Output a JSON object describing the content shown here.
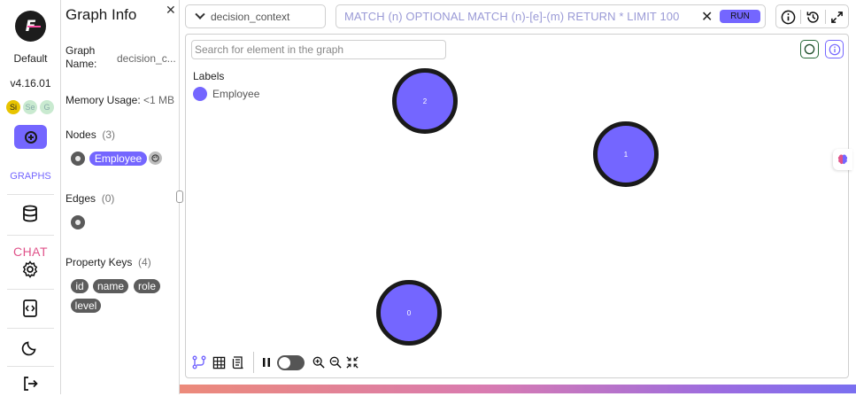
{
  "sidebar": {
    "logo_letter": "F",
    "workspace": "Default",
    "version": "v4.16.01",
    "avatars": [
      {
        "initials": "Si",
        "color": "#e8c400"
      },
      {
        "initials": "Se",
        "color": "#c9ead0"
      },
      {
        "initials": "G",
        "color": "#c9ead0"
      }
    ],
    "graphs_label": "GRAPHS",
    "chat_label": "CHAT"
  },
  "graph_info": {
    "title": "Graph Info",
    "graph_name_label": "Graph Name:",
    "graph_name_value": "decision_c...",
    "memory_label": "Memory Usage:",
    "memory_value": "<1 MB",
    "nodes_label": "Nodes",
    "nodes_count": "(3)",
    "node_labels": [
      "Employee"
    ],
    "edges_label": "Edges",
    "edges_count": "(0)",
    "property_keys_label": "Property Keys",
    "property_keys_count": "(4)",
    "property_keys": [
      "id",
      "name",
      "role",
      "level"
    ]
  },
  "toolbar": {
    "graph_select_value": "decision_context",
    "query_placeholder": "MATCH (n) OPTIONAL MATCH (n)-[e]-(m) RETURN * LIMIT 100",
    "run_label": "RUN"
  },
  "canvas": {
    "search_placeholder": "Search for element in the graph",
    "labels_title": "Labels",
    "legend": [
      {
        "label": "Employee",
        "color": "#7466ff"
      }
    ],
    "nodes": [
      {
        "id": "2"
      },
      {
        "id": "1"
      },
      {
        "id": "0"
      }
    ]
  },
  "colors": {
    "accent": "#7466ff",
    "node_border": "#1a1a1a",
    "chip_gray": "#5c5c5c"
  }
}
